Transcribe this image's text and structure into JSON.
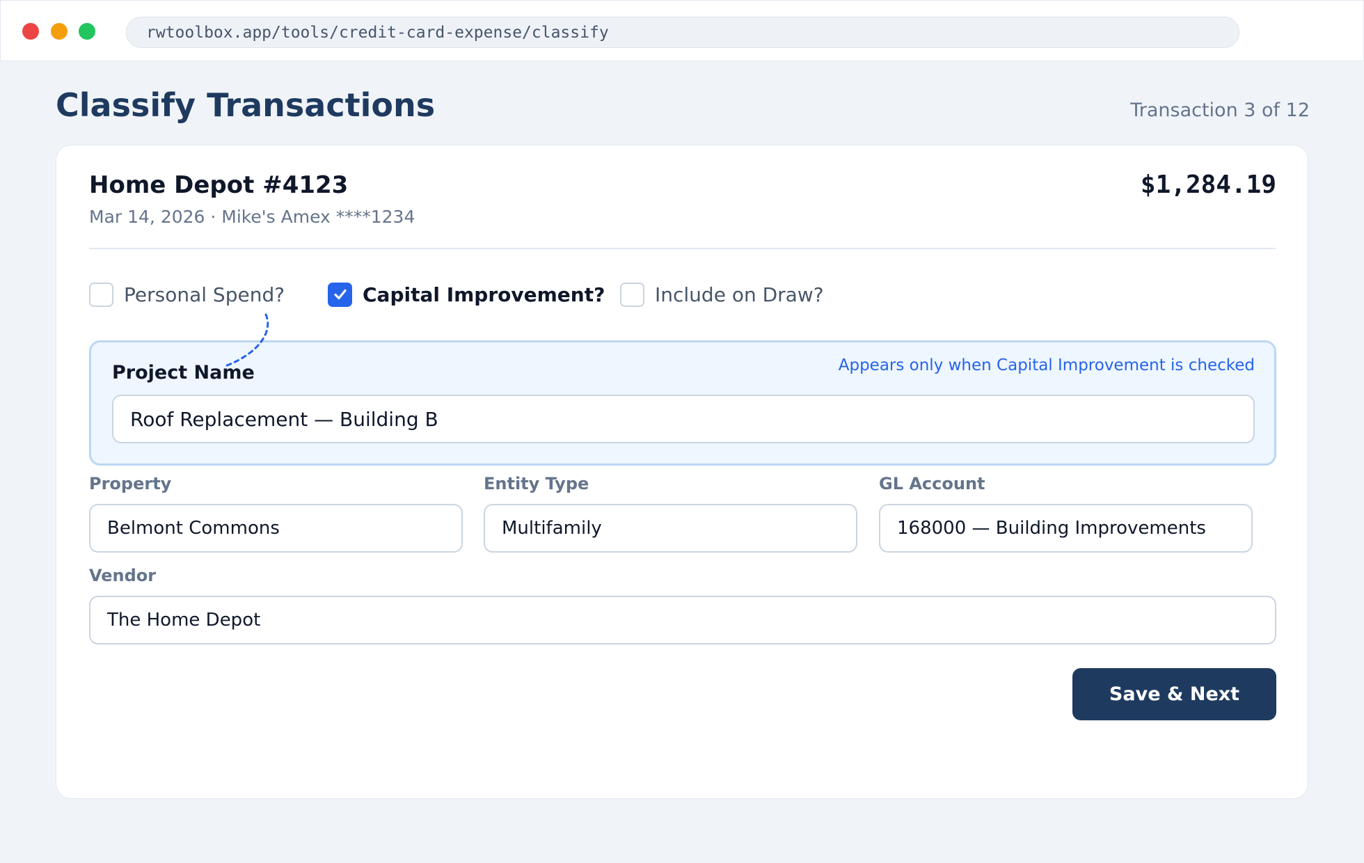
{
  "browser": {
    "url": "rwtoolbox.app/tools/credit-card-expense/classify"
  },
  "header": {
    "title": "Classify Transactions",
    "counter": "Transaction 3 of 12"
  },
  "transaction": {
    "merchant": "Home Depot #4123",
    "meta": "Mar 14, 2026 · Mike's Amex ****1234",
    "amount": "$1,284.19"
  },
  "flags": [
    {
      "label": "Personal Spend?",
      "checked": false
    },
    {
      "label": "Capital Improvement?",
      "checked": true
    },
    {
      "label": "Include on Draw?",
      "checked": false
    }
  ],
  "project": {
    "label": "Project Name",
    "hint": "Appears only when Capital Improvement is checked",
    "value": "Roof Replacement — Building B"
  },
  "fields": {
    "property": {
      "label": "Property",
      "value": "Belmont Commons"
    },
    "entity_type": {
      "label": "Entity Type",
      "value": "Multifamily"
    },
    "gl_account": {
      "label": "GL Account",
      "value": "168000 — Building Improvements"
    },
    "vendor": {
      "label": "Vendor",
      "value": "The Home Depot"
    }
  },
  "actions": {
    "save_label": "Save & Next"
  },
  "colors": {
    "primary": "#1e3a5f",
    "accent": "#2563eb",
    "background": "#f0f4f8"
  }
}
